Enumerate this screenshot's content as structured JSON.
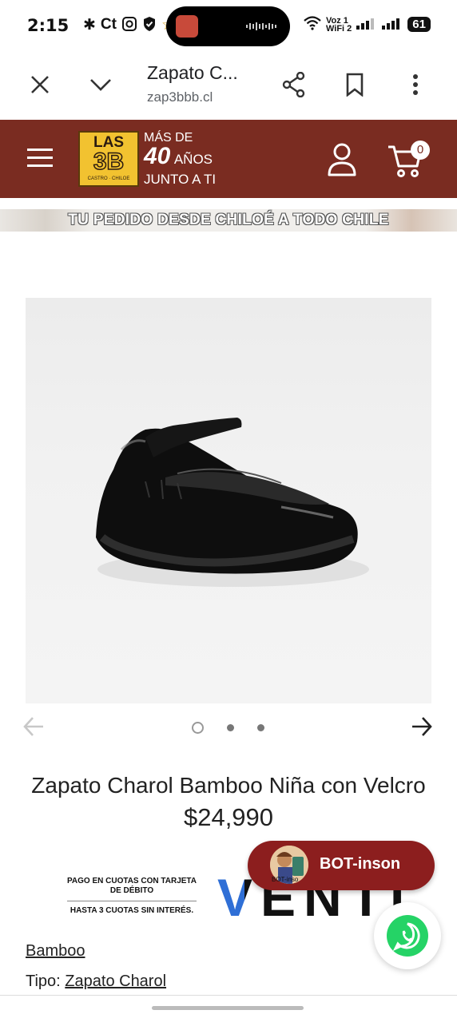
{
  "status_bar": {
    "time": "2:15",
    "left_icons": [
      "bluetooth-icon",
      "ct-icon",
      "instagram-icon",
      "shield-icon",
      "star-icon"
    ],
    "ct_label": "Ct",
    "network_label_top": "Voz 1",
    "network_label_bottom": "WiFi 2",
    "battery": "61"
  },
  "browser": {
    "page_title": "Zapato C...",
    "url": "zap3bbb.cl"
  },
  "site_header": {
    "logo_top": "LAS",
    "logo_main": "3B",
    "logo_sub": "CASTRO · CHILOE",
    "slogan_line1": "MÁS DE",
    "slogan_number": "40",
    "slogan_years": "AÑOS",
    "slogan_line3": "JUNTO A TI",
    "cart_count": "0",
    "colors": {
      "header_bg": "#7a2c21",
      "logo_yellow": "#f2c230"
    }
  },
  "banner": {
    "text": "TU PEDIDO DESDE CHILOÉ A TODO CHILE"
  },
  "carousel": {
    "slide_count": 3,
    "active_index": 0
  },
  "product": {
    "title": "Zapato Charol Bamboo Niña con Velcro",
    "price": "$24,990",
    "brand": "Bamboo",
    "type_label": "Tipo:",
    "type_value": "Zapato Charol"
  },
  "payment": {
    "line1": "PAGO EN CUOTAS CON TARJETA DE DÉBITO",
    "line2": "HASTA 3 CUOTAS SIN INTERÉS.",
    "logo_text": "VENTI"
  },
  "bot": {
    "label": "BOT-inson",
    "avatar_caption": "BOT-inso"
  }
}
